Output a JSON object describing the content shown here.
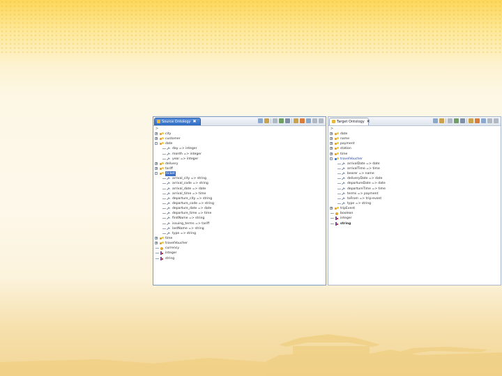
{
  "left_panel": {
    "title": "Source Ontology",
    "tab_close": "✖",
    "path": ">",
    "rows": [
      {
        "depth": 0,
        "twisty": "+",
        "icon": "type",
        "label": "city",
        "style": ""
      },
      {
        "depth": 0,
        "twisty": "+",
        "icon": "type",
        "label": "customer",
        "style": ""
      },
      {
        "depth": 0,
        "twisty": "-",
        "icon": "type",
        "label": "date",
        "style": ""
      },
      {
        "depth": 1,
        "twisty": "",
        "icon": "attr",
        "label": "day => integer",
        "style": ""
      },
      {
        "depth": 1,
        "twisty": "",
        "icon": "attr",
        "label": "month => integer",
        "style": ""
      },
      {
        "depth": 1,
        "twisty": "",
        "icon": "attr",
        "label": "year => integer",
        "style": ""
      },
      {
        "depth": 0,
        "twisty": "+",
        "icon": "type",
        "label": "delivery",
        "style": ""
      },
      {
        "depth": 0,
        "twisty": "+",
        "icon": "type",
        "label": "tariff",
        "style": ""
      },
      {
        "depth": 0,
        "twisty": "-",
        "icon": "type",
        "label": "ticket",
        "style": "sel"
      },
      {
        "depth": 1,
        "twisty": "",
        "icon": "attr",
        "label": "arrival_city => string",
        "style": ""
      },
      {
        "depth": 1,
        "twisty": "",
        "icon": "attr",
        "label": "arrival_code => string",
        "style": ""
      },
      {
        "depth": 1,
        "twisty": "",
        "icon": "attr",
        "label": "arrival_date => date",
        "style": ""
      },
      {
        "depth": 1,
        "twisty": "",
        "icon": "attr",
        "label": "arrival_time => time",
        "style": ""
      },
      {
        "depth": 1,
        "twisty": "",
        "icon": "attr",
        "label": "departure_city => string",
        "style": ""
      },
      {
        "depth": 1,
        "twisty": "",
        "icon": "attr",
        "label": "departure_code => string",
        "style": ""
      },
      {
        "depth": 1,
        "twisty": "",
        "icon": "attr",
        "label": "departure_date => date",
        "style": ""
      },
      {
        "depth": 1,
        "twisty": "",
        "icon": "attr",
        "label": "departure_time => time",
        "style": ""
      },
      {
        "depth": 1,
        "twisty": "",
        "icon": "attr",
        "label": "firstName => string",
        "style": ""
      },
      {
        "depth": 1,
        "twisty": "",
        "icon": "attr",
        "label": "issuing_terms => tariff",
        "style": ""
      },
      {
        "depth": 1,
        "twisty": "",
        "icon": "attr",
        "label": "lastName => string",
        "style": ""
      },
      {
        "depth": 1,
        "twisty": "",
        "icon": "attr",
        "label": "type => string",
        "style": ""
      },
      {
        "depth": 0,
        "twisty": "+",
        "icon": "type",
        "label": "time",
        "style": ""
      },
      {
        "depth": 0,
        "twisty": "+",
        "icon": "type",
        "label": "travelVoucher",
        "style": ""
      },
      {
        "depth": 0,
        "twisty": "",
        "icon": "bool",
        "label": "currency",
        "style": ""
      },
      {
        "depth": 0,
        "twisty": "",
        "icon": "prim",
        "label": "integer",
        "style": ""
      },
      {
        "depth": 0,
        "twisty": "",
        "icon": "prim",
        "label": "string",
        "style": ""
      }
    ]
  },
  "right_panel": {
    "title": "Target Ontology",
    "tab_close": "✕",
    "path": ">",
    "rows": [
      {
        "depth": 0,
        "twisty": "+",
        "icon": "type",
        "label": "date",
        "style": ""
      },
      {
        "depth": 0,
        "twisty": "+",
        "icon": "type",
        "label": "name",
        "style": ""
      },
      {
        "depth": 0,
        "twisty": "+",
        "icon": "type",
        "label": "payment",
        "style": ""
      },
      {
        "depth": 0,
        "twisty": "+",
        "icon": "type",
        "label": "station",
        "style": ""
      },
      {
        "depth": 0,
        "twisty": "+",
        "icon": "type",
        "label": "time",
        "style": ""
      },
      {
        "depth": 0,
        "twisty": "-",
        "icon": "typex",
        "label": "travelVoucher",
        "style": "hl"
      },
      {
        "depth": 1,
        "twisty": "",
        "icon": "attr",
        "label": "arrivalDate => date",
        "style": ""
      },
      {
        "depth": 1,
        "twisty": "",
        "icon": "attr",
        "label": "arrivalTime => time",
        "style": ""
      },
      {
        "depth": 1,
        "twisty": "",
        "icon": "attr",
        "label": "bearer => name",
        "style": ""
      },
      {
        "depth": 1,
        "twisty": "",
        "icon": "attr",
        "label": "deliveryDate => date",
        "style": ""
      },
      {
        "depth": 1,
        "twisty": "",
        "icon": "attr",
        "label": "departureDate => date",
        "style": ""
      },
      {
        "depth": 1,
        "twisty": "",
        "icon": "attr",
        "label": "departureTime => time",
        "style": ""
      },
      {
        "depth": 1,
        "twisty": "",
        "icon": "attr",
        "label": "terms => payment",
        "style": ""
      },
      {
        "depth": 1,
        "twisty": "",
        "icon": "attr",
        "label": "toFrom => trip-event",
        "style": ""
      },
      {
        "depth": 1,
        "twisty": "",
        "icon": "attr",
        "label": "type => string",
        "style": ""
      },
      {
        "depth": 0,
        "twisty": "+",
        "icon": "type",
        "label": "tripEvent",
        "style": ""
      },
      {
        "depth": 0,
        "twisty": "",
        "icon": "bool",
        "label": "boolean",
        "style": ""
      },
      {
        "depth": 0,
        "twisty": "",
        "icon": "prim",
        "label": "integer",
        "style": ""
      },
      {
        "depth": 0,
        "twisty": "",
        "icon": "prim",
        "label": "string",
        "style": "bold"
      }
    ]
  },
  "colors": {
    "selection": "#3a6fc8",
    "accent": "#fbd75a"
  }
}
